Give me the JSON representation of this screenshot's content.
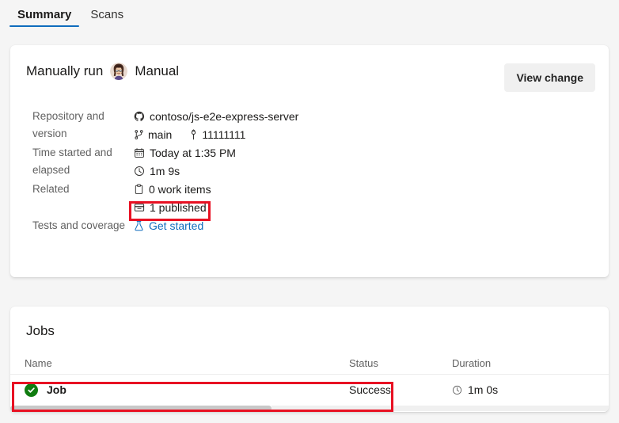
{
  "tabs": [
    {
      "label": "Summary",
      "active": true
    },
    {
      "label": "Scans",
      "active": false
    }
  ],
  "summary_card": {
    "run_title": "Manually run",
    "author": "Manual",
    "avatar_alt": "user-avatar",
    "view_change_label": "View change",
    "details": [
      {
        "label": "Repository and version",
        "lines": [
          {
            "icon": "github-icon",
            "text": "contoso/js-e2e-express-server"
          },
          {
            "icon": "branch-icon",
            "text": "main",
            "icon2": "commit-icon",
            "text2": "11111111"
          }
        ]
      },
      {
        "label": "Time started and elapsed",
        "lines": [
          {
            "icon": "calendar-icon",
            "text": "Today at 1:35 PM"
          },
          {
            "icon": "clock-icon",
            "text": "1m 9s"
          }
        ]
      },
      {
        "label": "Related",
        "lines": [
          {
            "icon": "clipboard-icon",
            "text": "0 work items"
          },
          {
            "icon": "package-icon",
            "text": "1 published",
            "highlighted": true
          }
        ]
      },
      {
        "label": "Tests and coverage",
        "lines": [
          {
            "icon": "beaker-icon",
            "text": "Get started",
            "link": true
          }
        ]
      }
    ]
  },
  "jobs_card": {
    "title": "Jobs",
    "columns": [
      "Name",
      "Status",
      "Duration"
    ],
    "rows": [
      {
        "status_icon": "success-check-icon",
        "name": "Job",
        "status": "Success",
        "duration_icon": "clock-icon",
        "duration": "1m 0s",
        "highlighted": true
      }
    ]
  },
  "colors": {
    "accent_blue": "#0f6cbd",
    "annotation_red": "#e81123",
    "success_green": "#107c10",
    "page_bg": "#f5f5f5",
    "card_bg": "#ffffff",
    "label_gray": "#616161"
  }
}
